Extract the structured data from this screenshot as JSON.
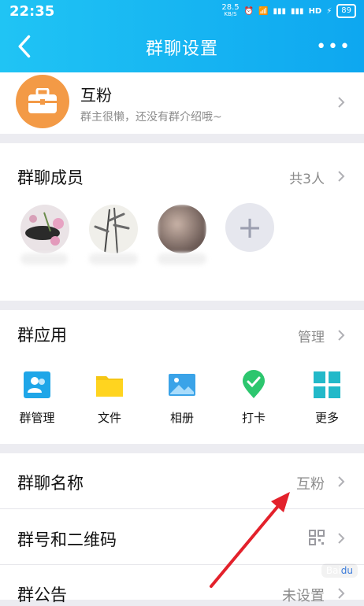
{
  "status": {
    "time": "22:35",
    "speed_value": "28.5",
    "speed_unit": "KB/S",
    "battery": "89"
  },
  "nav": {
    "title": "群聊设置",
    "more": "•••"
  },
  "group": {
    "name": "互粉",
    "desc": "群主很懒，还没有群介绍哦~"
  },
  "members": {
    "title": "群聊成员",
    "count": "共3人",
    "add_symbol": "+"
  },
  "apps": {
    "title": "群应用",
    "manage": "管理",
    "items": [
      "群管理",
      "文件",
      "相册",
      "打卡",
      "更多"
    ]
  },
  "rows": {
    "name_title": "群聊名称",
    "name_value": "互粉",
    "qr_title": "群号和二维码",
    "notice_title": "群公告",
    "notice_value": "未设置"
  },
  "colors": {
    "accent": "#0ea7f0",
    "orange": "#f39a46",
    "arrow": "#e3212b",
    "green": "#2cc66e"
  }
}
